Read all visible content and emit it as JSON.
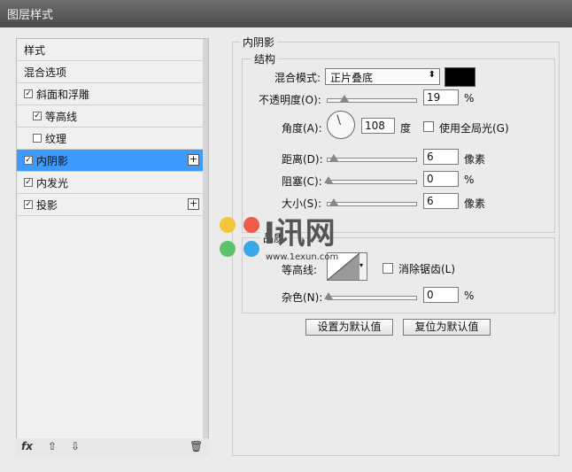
{
  "window_title": "图层样式",
  "left_panel": {
    "items": [
      {
        "label": "样式",
        "check": false,
        "checked": false,
        "plus": false
      },
      {
        "label": "混合选项",
        "check": false,
        "checked": false,
        "plus": false
      },
      {
        "label": "斜面和浮雕",
        "check": true,
        "checked": true,
        "plus": false
      },
      {
        "label": "等高线",
        "check": true,
        "checked": true,
        "plus": false
      },
      {
        "label": "纹理",
        "check": true,
        "checked": false,
        "plus": false
      },
      {
        "label": "内阴影",
        "check": true,
        "checked": true,
        "plus": true,
        "selected": true
      },
      {
        "label": "内发光",
        "check": true,
        "checked": true,
        "plus": false
      },
      {
        "label": "投影",
        "check": true,
        "checked": true,
        "plus": true
      }
    ],
    "footer": {
      "fx": "fx",
      "up": "⇧",
      "down": "⇩",
      "trash": "🗑"
    }
  },
  "inner_shadow": {
    "title": "内阴影",
    "structure": {
      "title": "结构",
      "blend_mode_label": "混合模式:",
      "blend_mode_value": "正片叠底",
      "color": "#000000",
      "opacity_label": "不透明度(O):",
      "opacity_value": "19",
      "opacity_unit": "%",
      "angle_label": "角度(A):",
      "angle_value": "108",
      "angle_unit": "度",
      "global_light_label": "使用全局光(G)",
      "distance_label": "距离(D):",
      "distance_value": "6",
      "distance_unit": "像素",
      "choke_label": "阻塞(C):",
      "choke_value": "0",
      "choke_unit": "%",
      "size_label": "大小(S):",
      "size_value": "6",
      "size_unit": "像素"
    },
    "quality": {
      "title": "品质",
      "contour_label": "等高线:",
      "anti_alias_label": "消除锯齿(L)",
      "noise_label": "杂色(N):",
      "noise_value": "0",
      "noise_unit": "%"
    },
    "buttons": {
      "set_default": "设置为默认值",
      "reset_default": "复位为默认值"
    }
  },
  "watermark": {
    "brand": "I讯网",
    "url": "www.1exun.com"
  }
}
